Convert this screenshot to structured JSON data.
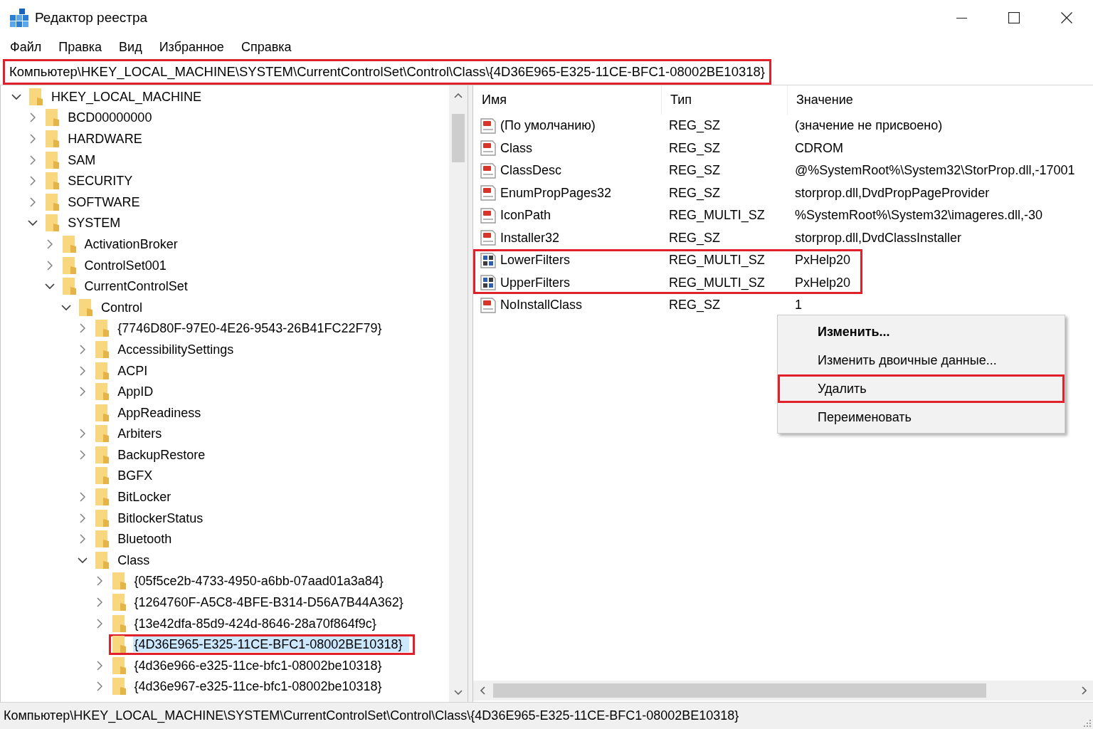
{
  "window": {
    "title": "Редактор реестра"
  },
  "menu": [
    "Файл",
    "Правка",
    "Вид",
    "Избранное",
    "Справка"
  ],
  "address_bar": {
    "path": "Компьютер\\HKEY_LOCAL_MACHINE\\SYSTEM\\CurrentControlSet\\Control\\Class\\{4D36E965-E325-11CE-BFC1-08002BE10318}",
    "highlighted": true
  },
  "tree": [
    {
      "label": "HKEY_LOCAL_MACHINE",
      "has_children": true,
      "expanded": true,
      "selected": false,
      "highlighted": false,
      "children": [
        {
          "label": "BCD00000000",
          "has_children": true,
          "expanded": false,
          "selected": false,
          "highlighted": false
        },
        {
          "label": "HARDWARE",
          "has_children": true,
          "expanded": false,
          "selected": false,
          "highlighted": false
        },
        {
          "label": "SAM",
          "has_children": true,
          "expanded": false,
          "selected": false,
          "highlighted": false
        },
        {
          "label": "SECURITY",
          "has_children": true,
          "expanded": false,
          "selected": false,
          "highlighted": false
        },
        {
          "label": "SOFTWARE",
          "has_children": true,
          "expanded": false,
          "selected": false,
          "highlighted": false
        },
        {
          "label": "SYSTEM",
          "has_children": true,
          "expanded": true,
          "selected": false,
          "highlighted": false,
          "children": [
            {
              "label": "ActivationBroker",
              "has_children": true,
              "expanded": false,
              "selected": false,
              "highlighted": false
            },
            {
              "label": "ControlSet001",
              "has_children": true,
              "expanded": false,
              "selected": false,
              "highlighted": false
            },
            {
              "label": "CurrentControlSet",
              "has_children": true,
              "expanded": true,
              "selected": false,
              "highlighted": false,
              "children": [
                {
                  "label": "Control",
                  "has_children": true,
                  "expanded": true,
                  "selected": false,
                  "highlighted": false,
                  "children": [
                    {
                      "label": "{7746D80F-97E0-4E26-9543-26B41FC22F79}",
                      "has_children": true,
                      "expanded": false,
                      "selected": false,
                      "highlighted": false
                    },
                    {
                      "label": "AccessibilitySettings",
                      "has_children": true,
                      "expanded": false,
                      "selected": false,
                      "highlighted": false
                    },
                    {
                      "label": "ACPI",
                      "has_children": true,
                      "expanded": false,
                      "selected": false,
                      "highlighted": false
                    },
                    {
                      "label": "AppID",
                      "has_children": true,
                      "expanded": false,
                      "selected": false,
                      "highlighted": false
                    },
                    {
                      "label": "AppReadiness",
                      "has_children": false,
                      "selected": false,
                      "highlighted": false
                    },
                    {
                      "label": "Arbiters",
                      "has_children": true,
                      "expanded": false,
                      "selected": false,
                      "highlighted": false
                    },
                    {
                      "label": "BackupRestore",
                      "has_children": true,
                      "expanded": false,
                      "selected": false,
                      "highlighted": false
                    },
                    {
                      "label": "BGFX",
                      "has_children": false,
                      "selected": false,
                      "highlighted": false
                    },
                    {
                      "label": "BitLocker",
                      "has_children": true,
                      "expanded": false,
                      "selected": false,
                      "highlighted": false
                    },
                    {
                      "label": "BitlockerStatus",
                      "has_children": true,
                      "expanded": false,
                      "selected": false,
                      "highlighted": false
                    },
                    {
                      "label": "Bluetooth",
                      "has_children": true,
                      "expanded": false,
                      "selected": false,
                      "highlighted": false
                    },
                    {
                      "label": "Class",
                      "has_children": true,
                      "expanded": true,
                      "selected": false,
                      "highlighted": false,
                      "children": [
                        {
                          "label": "{05f5ce2b-4733-4950-a6bb-07aad01a3a84}",
                          "has_children": true,
                          "expanded": false,
                          "selected": false,
                          "highlighted": false
                        },
                        {
                          "label": "{1264760F-A5C8-4BFE-B314-D56A7B44A362}",
                          "has_children": true,
                          "expanded": false,
                          "selected": false,
                          "highlighted": false
                        },
                        {
                          "label": "{13e42dfa-85d9-424d-8646-28a70f864f9c}",
                          "has_children": true,
                          "expanded": false,
                          "selected": false,
                          "highlighted": false
                        },
                        {
                          "label": "{4D36E965-E325-11CE-BFC1-08002BE10318}",
                          "has_children": false,
                          "selected": true,
                          "highlighted": true
                        },
                        {
                          "label": "{4d36e966-e325-11ce-bfc1-08002be10318}",
                          "has_children": true,
                          "expanded": false,
                          "selected": false,
                          "highlighted": false
                        },
                        {
                          "label": "{4d36e967-e325-11ce-bfc1-08002be10318}",
                          "has_children": true,
                          "expanded": false,
                          "selected": false,
                          "highlighted": false
                        }
                      ]
                    }
                  ]
                }
              ]
            }
          ]
        }
      ]
    }
  ],
  "values": {
    "columns": [
      "Имя",
      "Тип",
      "Значение"
    ],
    "rows": [
      {
        "kind": "string",
        "name": "(По умолчанию)",
        "type": "REG_SZ",
        "data": "(значение не присвоено)",
        "highlighted": false
      },
      {
        "kind": "string",
        "name": "Class",
        "type": "REG_SZ",
        "data": "CDROM",
        "highlighted": false
      },
      {
        "kind": "string",
        "name": "ClassDesc",
        "type": "REG_SZ",
        "data": "@%SystemRoot%\\System32\\StorProp.dll,-17001",
        "highlighted": false
      },
      {
        "kind": "string",
        "name": "EnumPropPages32",
        "type": "REG_SZ",
        "data": "storprop.dll,DvdPropPageProvider",
        "highlighted": false
      },
      {
        "kind": "string",
        "name": "IconPath",
        "type": "REG_MULTI_SZ",
        "data": "%SystemRoot%\\System32\\imageres.dll,-30",
        "highlighted": false
      },
      {
        "kind": "string",
        "name": "Installer32",
        "type": "REG_SZ",
        "data": "storprop.dll,DvdClassInstaller",
        "highlighted": false
      },
      {
        "kind": "binary",
        "name": "LowerFilters",
        "type": "REG_MULTI_SZ",
        "data": "PxHelp20",
        "highlighted": true
      },
      {
        "kind": "binary",
        "name": "UpperFilters",
        "type": "REG_MULTI_SZ",
        "data": "PxHelp20",
        "highlighted": true
      },
      {
        "kind": "string",
        "name": "NoInstallClass",
        "type": "REG_SZ",
        "data": "1",
        "highlighted": false
      }
    ]
  },
  "context_menu": {
    "items": [
      {
        "label": "Изменить...",
        "default": true,
        "highlighted": false
      },
      {
        "label": "Изменить двоичные данные...",
        "default": false,
        "highlighted": false
      },
      {
        "label": "Удалить",
        "default": false,
        "highlighted": true
      },
      {
        "label": "Переименовать",
        "default": false,
        "highlighted": false
      }
    ]
  },
  "status_bar": {
    "path": "Компьютер\\HKEY_LOCAL_MACHINE\\SYSTEM\\CurrentControlSet\\Control\\Class\\{4D36E965-E325-11CE-BFC1-08002BE10318}"
  }
}
